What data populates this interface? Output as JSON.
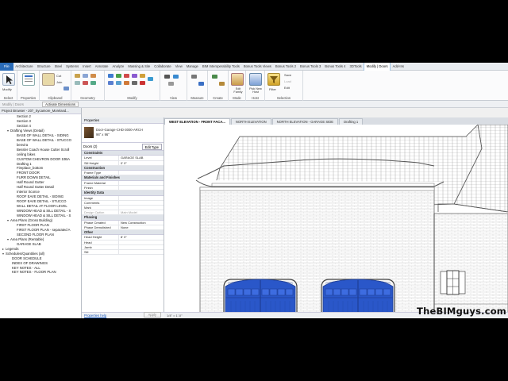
{
  "ribbon": {
    "tabs": [
      "File",
      "Architecture",
      "Structure",
      "Steel",
      "Systems",
      "Insert",
      "Annotate",
      "Analyze",
      "Massing & Site",
      "Collaborate",
      "View",
      "Manage",
      "BIM Interoperability Tools",
      "Bonus Tools Views",
      "Bonus Tools 2",
      "Bonus Tools 3",
      "Bonus Tools 4",
      "3DTools",
      "Modify | Doors",
      "Add-Ins"
    ],
    "active_tab": "Modify | Doors",
    "groups": [
      {
        "label": "Select",
        "big": "Modify"
      },
      {
        "label": "Properties",
        "big": ""
      },
      {
        "label": "Clipboard",
        "big": "Paste"
      },
      {
        "label": "Geometry",
        "big": ""
      },
      {
        "label": "Modify",
        "big": ""
      },
      {
        "label": "View",
        "big": ""
      },
      {
        "label": "Measure",
        "big": ""
      },
      {
        "label": "Create",
        "big": ""
      },
      {
        "label": "Mode",
        "big": "Edit Family"
      },
      {
        "label": "Host",
        "big": "Pick New Host"
      },
      {
        "label": "Selection",
        "big": "Filter"
      }
    ],
    "small_labels": {
      "cut": "Cut",
      "join": "Join",
      "save": "Save",
      "load": "Load",
      "edit": "Edit"
    }
  },
  "options_bar": {
    "text": "Modify | Doors"
  },
  "activate_dimensions": "Activate Dimensions",
  "browser": {
    "title": "Project Browser - 207_Sycamore_Moreland...",
    "items": [
      {
        "t": "Section 2",
        "lvl": 3
      },
      {
        "t": "Section 3",
        "lvl": 3
      },
      {
        "t": "Section 4",
        "lvl": 3
      },
      {
        "t": "Drafting Views (Detail)",
        "lvl": 1,
        "exp": true
      },
      {
        "t": "BASE OF WALL DETAIL - SIDING",
        "lvl": 3
      },
      {
        "t": "BASE OF WALL DETAIL - STUCCO",
        "lvl": 3
      },
      {
        "t": "benvira",
        "lvl": 3
      },
      {
        "t": "Bessler Coach House Cutter Scroll",
        "lvl": 3
      },
      {
        "t": "ceiling bikes",
        "lvl": 3
      },
      {
        "t": "CUSTOM CHEVRON DOOR 10BA",
        "lvl": 3
      },
      {
        "t": "Drafting 1",
        "lvl": 3
      },
      {
        "t": "Fireplace_bottom",
        "lvl": 3
      },
      {
        "t": "FRONT DOOR",
        "lvl": 3
      },
      {
        "t": "FURR DOWN DETAIL",
        "lvl": 3
      },
      {
        "t": "Half Round Gutter",
        "lvl": 3
      },
      {
        "t": "Half Round Gutter Detail",
        "lvl": 3
      },
      {
        "t": "Interior Sconce",
        "lvl": 3
      },
      {
        "t": "ROOF EAVE DETAIL - SIDING",
        "lvl": 3
      },
      {
        "t": "ROOF EAVE DETAIL - STUCCO",
        "lvl": 3
      },
      {
        "t": "WALL DETAIL AT FLOOR LEVEL",
        "lvl": 3
      },
      {
        "t": "WINDOW HEAD & SILL DETAIL - S",
        "lvl": 3
      },
      {
        "t": "WINDOW HEAD & SILL DETAIL - S",
        "lvl": 3
      },
      {
        "t": "Area Plans (Gross Building)",
        "lvl": 1,
        "exp": true
      },
      {
        "t": "FIRST FLOOR PLAN",
        "lvl": 3
      },
      {
        "t": "FIRST FLOOR PLAN - separated A",
        "lvl": 3
      },
      {
        "t": "SECOND FLOOR PLAN",
        "lvl": 3
      },
      {
        "t": "Area Plans (Rentable)",
        "lvl": 1,
        "exp": true
      },
      {
        "t": "GARAGE SLAB",
        "lvl": 3
      },
      {
        "t": "Legends",
        "lvl": 0
      },
      {
        "t": "Schedules/Quantities (all)",
        "lvl": 0,
        "exp": true
      },
      {
        "t": "DOOR SCHEDULE",
        "lvl": 2
      },
      {
        "t": "INDEX OF DRAWINGS",
        "lvl": 2
      },
      {
        "t": "KEY NOTES - ALL",
        "lvl": 2
      },
      {
        "t": "KEY NOTES - FLOOR PLAN",
        "lvl": 2
      }
    ]
  },
  "properties": {
    "title": "Properties",
    "type_line1": "Door-Garage-CHD-3000-ARCH",
    "type_line2": "96\" x 96\"",
    "instance": "Doors (2)",
    "edit_type": "Edit Type",
    "rows": [
      {
        "cat": "Constraints"
      },
      {
        "k": "Level",
        "v": "GARAGE SLAB"
      },
      {
        "k": "Sill Height",
        "v": "0' 0\""
      },
      {
        "cat": "Construction"
      },
      {
        "k": "Frame Type",
        "v": ""
      },
      {
        "cat": "Materials and Finishes"
      },
      {
        "k": "Frame Material",
        "v": ""
      },
      {
        "k": "Finish",
        "v": ""
      },
      {
        "cat": "Identity Data"
      },
      {
        "k": "Image",
        "v": ""
      },
      {
        "k": "Comments",
        "v": ""
      },
      {
        "k": "Mark",
        "v": ""
      },
      {
        "k": "Design Option",
        "v": "Main Model",
        "grey": true
      },
      {
        "cat": "Phasing"
      },
      {
        "k": "Phase Created",
        "v": "New Construction"
      },
      {
        "k": "Phase Demolished",
        "v": "None"
      },
      {
        "cat": "Other"
      },
      {
        "k": "Head Height",
        "v": "8' 0\""
      },
      {
        "k": "Head",
        "v": ""
      },
      {
        "k": "Jamb",
        "v": ""
      },
      {
        "k": "Sill",
        "v": ""
      }
    ],
    "help_link": "Properties help",
    "apply": "Apply"
  },
  "view_tabs": [
    {
      "label": "WEST ELEVATION - FRONT FACA...",
      "active": true
    },
    {
      "label": "NORTH ELEVATION",
      "active": false
    },
    {
      "label": "NORTH ELEVATION - GARAGE SIDE",
      "active": false
    },
    {
      "label": "Drafting 1",
      "active": false
    }
  ],
  "view_control_bar": "1/4\" = 1'-0\"",
  "watermark": "TheBIMguys.com",
  "colors": {
    "door_blue": "#2a57c9",
    "door_dark": "#1f3f96",
    "selection_blue": "#2b6fd0"
  }
}
